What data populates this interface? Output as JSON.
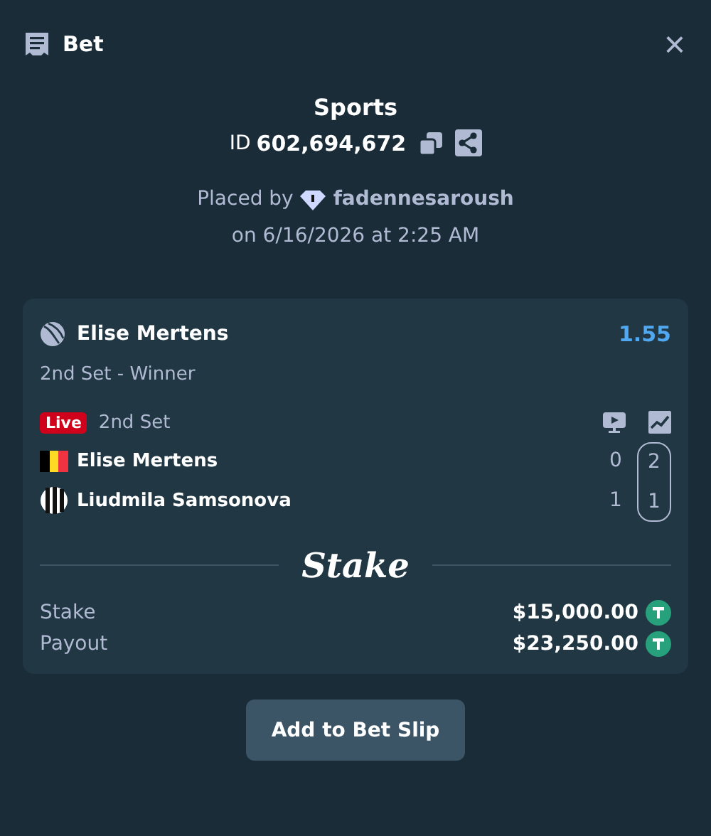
{
  "header": {
    "title": "Bet",
    "close": "×"
  },
  "summary": {
    "category": "Sports",
    "id_label": "ID",
    "id_value": "602,694,672",
    "placed_by": "Placed by",
    "user": "fadennesaroush",
    "date": "on 6/16/2026 at 2:25 AM"
  },
  "selection": {
    "pick": "Elise Mertens",
    "odds": "1.55",
    "market": "2nd Set - Winner",
    "live_badge": "Live",
    "period": "2nd Set",
    "players": [
      {
        "name": "Elise Mertens",
        "kind": "flag",
        "scores": [
          "0",
          "2"
        ]
      },
      {
        "name": "Liudmila Samsonova",
        "kind": "neutral",
        "scores": [
          "1",
          "1"
        ]
      }
    ]
  },
  "brand": "Stake",
  "totals": [
    {
      "label": "Stake",
      "amount": "$15,000.00"
    },
    {
      "label": "Payout",
      "amount": "$23,250.00"
    }
  ],
  "button": "Add to Bet Slip"
}
